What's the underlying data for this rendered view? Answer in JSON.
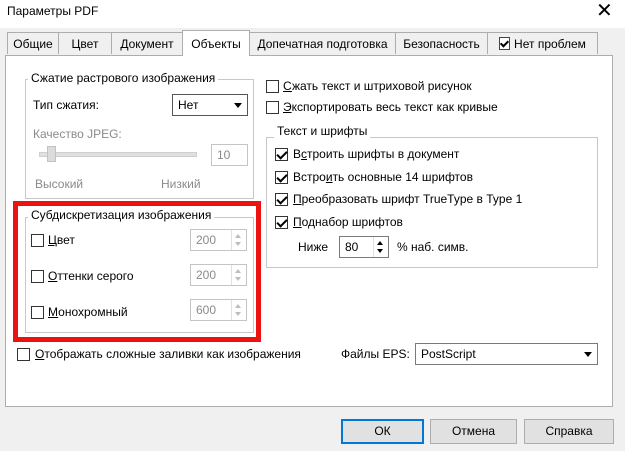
{
  "window": {
    "title": "Параметры PDF",
    "close_glyph": "✕"
  },
  "tabs": [
    {
      "label": "Общие"
    },
    {
      "label": "Цвет"
    },
    {
      "label": "Документ"
    },
    {
      "label": "Объекты",
      "active": true
    },
    {
      "label": "Допечатная подготовка"
    },
    {
      "label": "Безопасность"
    },
    {
      "label": "Нет проблем",
      "icon": "checklist-icon"
    }
  ],
  "compression": {
    "legend": "Сжатие растрового изображения",
    "type_label": "Тип сжатия:",
    "type_value": "Нет",
    "jpeg_label": "Качество JPEG:",
    "jpeg_value": "10",
    "jpeg_level": 0.05,
    "high_label": "Высокий",
    "low_label": "Низкий"
  },
  "downsample": {
    "legend": "Субдискретизация изображения",
    "items": [
      {
        "label_first": "Ц",
        "label_rest": "вет",
        "value": "200",
        "checked": false
      },
      {
        "label_first": "О",
        "label_rest": "ттенки серого",
        "value": "200",
        "checked": false
      },
      {
        "label_first": "М",
        "label_rest": "онохромный",
        "value": "600",
        "checked": false
      }
    ]
  },
  "right_checks": [
    {
      "label_first": "С",
      "label_rest": "жать текст и штриховой рисунок",
      "checked": false
    },
    {
      "label_first": "Э",
      "label_rest": "кспортировать весь текст как кривые",
      "checked": false
    }
  ],
  "fonts": {
    "legend": "Текст и шрифты",
    "items": [
      {
        "label_pre": "В",
        "label_u": "с",
        "label_rest": "троить шрифты в документ",
        "checked": true
      },
      {
        "label_pre": "Встро",
        "label_u": "и",
        "label_rest": "ть основные 14 шрифтов",
        "checked": true
      },
      {
        "label_pre": "",
        "label_u": "П",
        "label_rest": "реобразовать шрифт TrueType в Type 1",
        "checked": true
      },
      {
        "label_pre": "",
        "label_u": "П",
        "label_rest": "однабор шрифтов",
        "checked": true
      }
    ],
    "below_label": "Ниже",
    "below_value": "80",
    "below_suffix": "% наб. симв."
  },
  "complex_fills": {
    "label_first": "О",
    "label_rest": "тображать сложные заливки как изображения",
    "checked": false
  },
  "eps": {
    "label": "Файлы EPS:",
    "value": "PostScript"
  },
  "buttons": {
    "ok": "ОК",
    "cancel": "Отмена",
    "help": "Справка"
  },
  "colors": {
    "highlight": "#ee1111",
    "accent": "#0078d7"
  }
}
